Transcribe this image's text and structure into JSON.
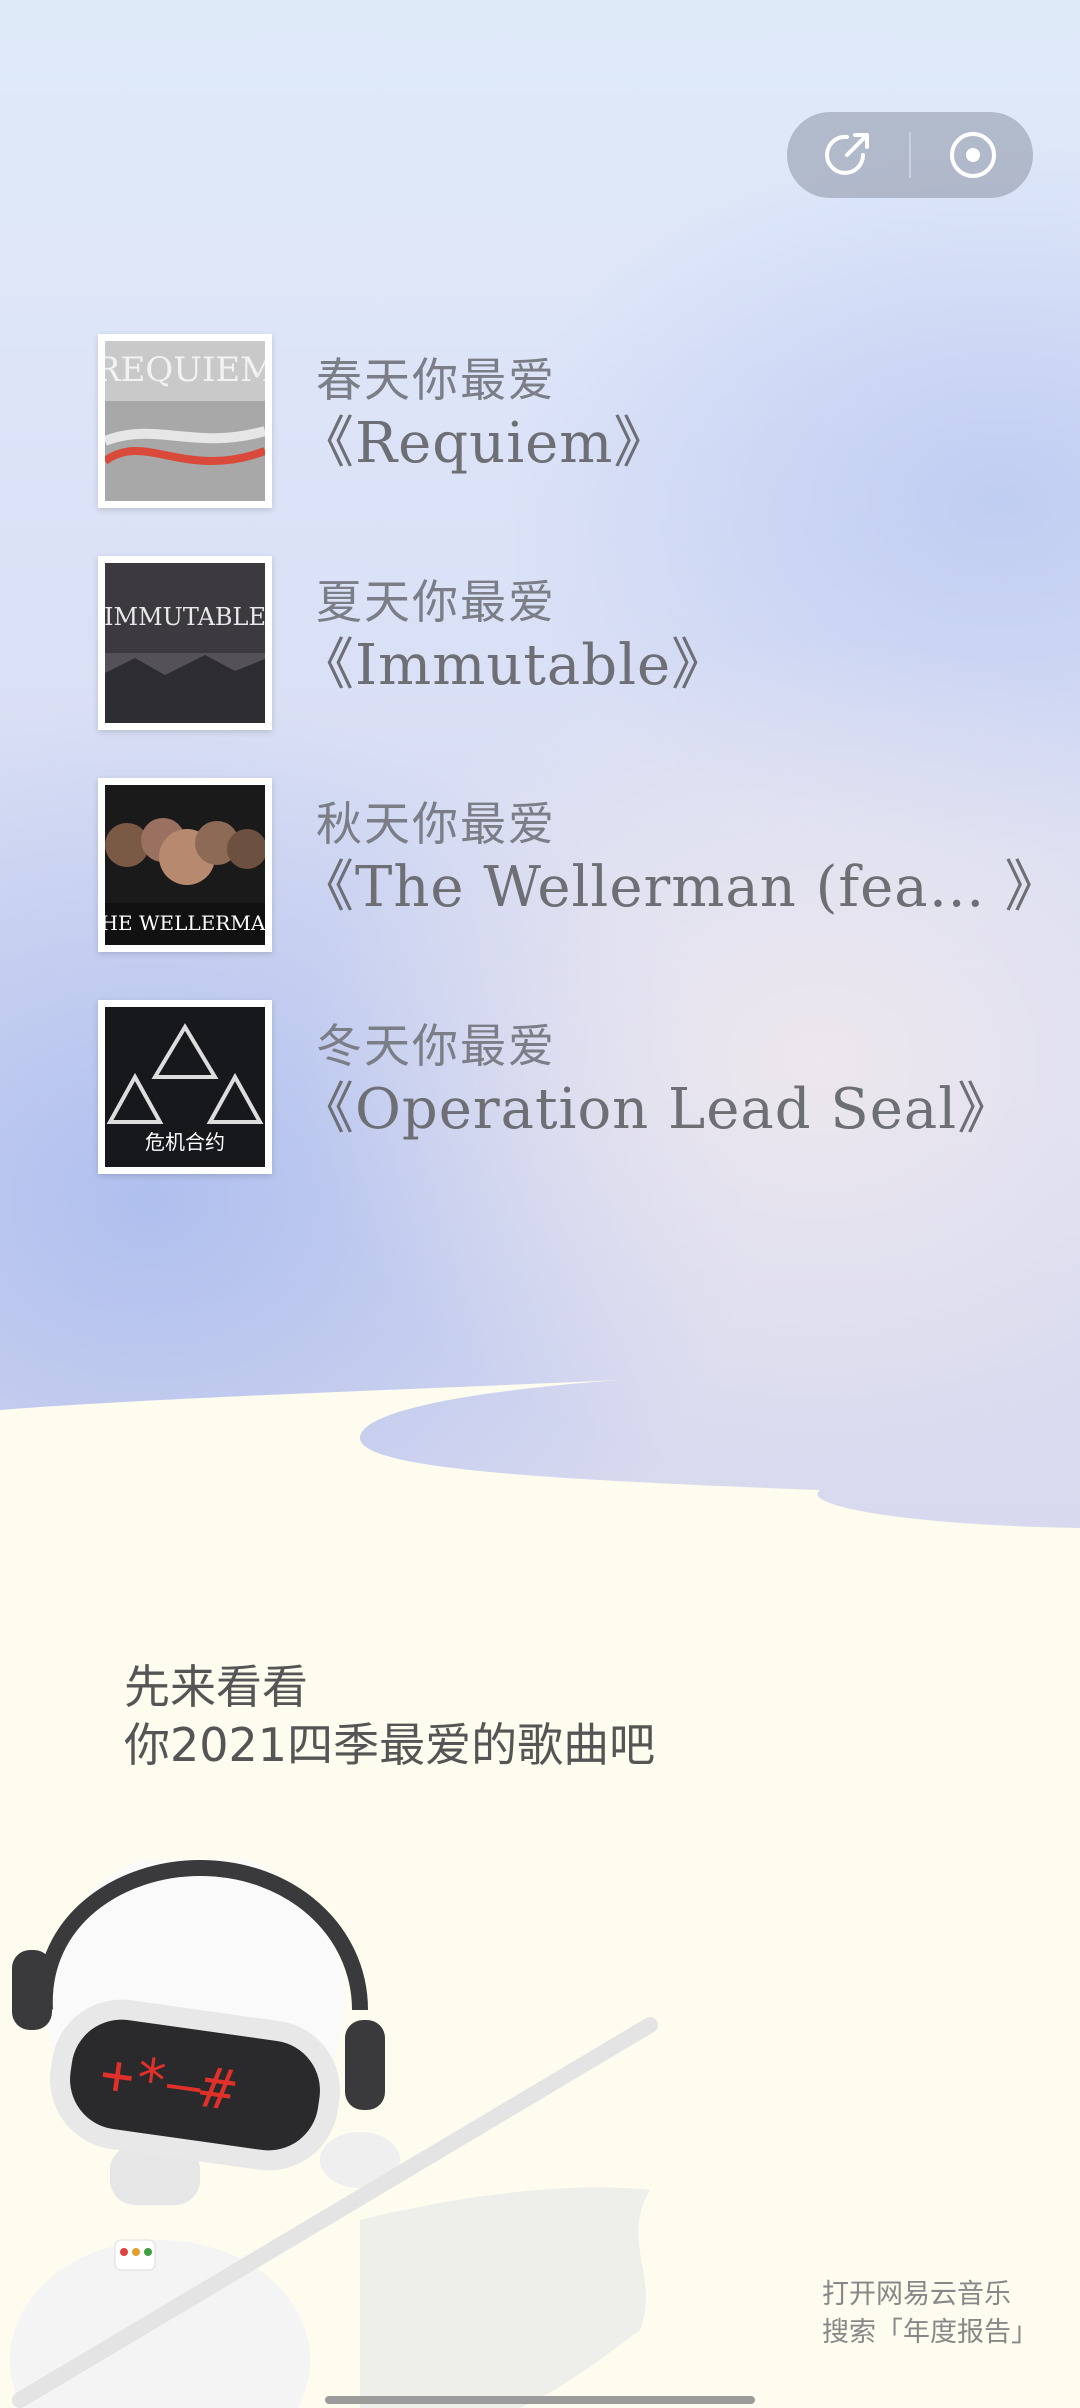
{
  "header": {
    "share_icon": "share-arrow-icon",
    "target_icon": "record-target-icon"
  },
  "songs": [
    {
      "season": "春天你最爱",
      "title": "《Requiem》",
      "cover_text": "REQUIEM"
    },
    {
      "season": "夏天你最爱",
      "title": "《Immutable》",
      "cover_text": "IMMUTABLE"
    },
    {
      "season": "秋天你最爱",
      "title": "《The  Wellerman  (fea… 》",
      "cover_text": "THE WELLERMAN"
    },
    {
      "season": "冬天你最爱",
      "title": "《Operation  Lead  Seal》",
      "cover_text": "危机合约"
    }
  ],
  "intro": {
    "line1": "先来看看",
    "line2": "你2021四季最爱的歌曲吧"
  },
  "promo": {
    "line1": "打开网易云音乐",
    "line2": "搜索「年度报告」"
  },
  "colors": {
    "ground": "#fdfcef",
    "sky_top": "#dfeaf9",
    "sky_blue": "#a8baee"
  }
}
